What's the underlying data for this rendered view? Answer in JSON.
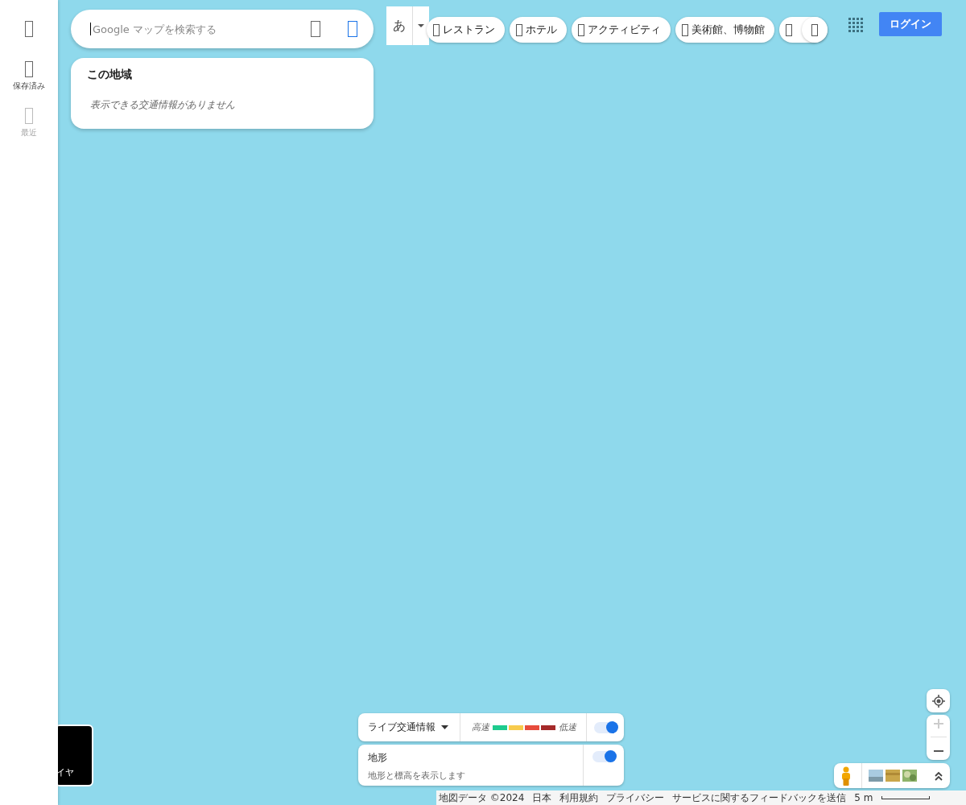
{
  "sidebar": {
    "items": [
      {
        "disabled": false
      },
      {
        "label": "保存済み",
        "disabled": false
      },
      {
        "label": "最近",
        "disabled": true
      }
    ]
  },
  "search": {
    "placeholder": "Google マップを検索する"
  },
  "traffic_card": {
    "title": "この地域",
    "message": "表示できる交通情報がありません"
  },
  "input_method": {
    "label": "あ"
  },
  "chips": [
    {
      "kind": "full",
      "label": "レストラン"
    },
    {
      "kind": "full",
      "label": "ホテル"
    },
    {
      "kind": "full",
      "label": "アクティビティ"
    },
    {
      "kind": "full",
      "label": "美術館、博物館"
    },
    {
      "kind": "partial"
    }
  ],
  "login": {
    "label": "ログイン"
  },
  "layer_tile": {
    "label": "イヤ"
  },
  "live_traffic": {
    "label": "ライブ交通情報",
    "fast": "高速",
    "slow": "低速",
    "legend": [
      {
        "color": "#1ecb8e"
      },
      {
        "color": "#f7cb4d"
      },
      {
        "color": "#e74c3c"
      },
      {
        "color": "#a52a2a"
      }
    ],
    "on": true
  },
  "terrain": {
    "title": "地形",
    "description": "地形と標高を表示します",
    "on": true
  },
  "footer": {
    "items": [
      "地図データ ©2024",
      "日本",
      "利用規約",
      "プライバシー",
      "サービスに関するフィードバックを送信"
    ],
    "scale": "5 m"
  }
}
